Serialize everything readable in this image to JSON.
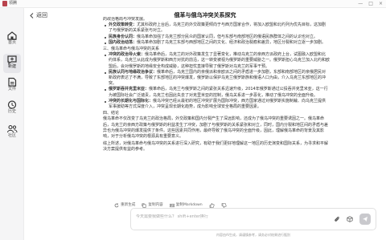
{
  "window": {
    "app_name": "领腾",
    "logo_color": "#b9434d",
    "controls": [
      "—",
      "□",
      "×"
    ]
  },
  "sidebar": {
    "items": [
      {
        "label": "首页",
        "icon": "home-icon"
      },
      {
        "label": "新建",
        "icon": "new-chat-icon",
        "active": true
      },
      {
        "label": "文件",
        "icon": "file-icon"
      },
      {
        "label": "历史",
        "icon": "history-icon"
      },
      {
        "label": "社区",
        "icon": "community-icon"
      }
    ]
  },
  "header": {
    "back_label": "返回",
    "title": "俄革与俄乌冲突关系探究"
  },
  "content": {
    "p0": "的政治格局与冲突发展。",
    "b1": "外交政策转变：",
    "b1t": "尤其科政府上台后，乌克兰的外交政策更倾向于与西方国家合作，将加入欧盟和北约列为优先目标，这加剧了与俄罗斯的关系紧张与对立。",
    "b2": "民族身份认同：",
    "b2t": "俄乌革命加强了乌克兰部分民众的国家认同，但与东部与南部地区的俄语民族群体之间的认识也对立。",
    "b3": "国内政治动荡：",
    "b3t": "俄乌革命加剧了乌克兰东部与西部地区之间的文化、经济和政治裂痕和差异，地区分裂和对立逐一步加剧。",
    "sec3": "三、俄乌革命与俄乌冲突的关系",
    "c1": "冲突的政治导火索：",
    "c1t": "俄乌革命后，乌克兰的对外政策发生了显著变化，推动乌克兰的亲西方派政府上台，试图融入欧盟和北约体系，乌克兰从此成为俄罗斯和西方对抗的前沿，这一转变被视为俄罗斯的重要威胁之一。俄罗斯担心乌克兰加入北约和欧盟后，会对俄罗斯的地缘安全构成威胁，这种担忧直接导致了俄罗斯对乌克兰的军事干预。",
    "c2": "民族认同与地缘政治争议：",
    "c2t": "俄革命后，乌克兰国内的亲俄派和亲欧派之间的矛盾进一步加剧，东部和南部地区的亲俄居民对新政府表达了不满，导致了东部地区的冲突爆发，俄罗斯以保护乌克兰俄罗斯族和俄语人口为由，介入乌克兰东部地区的冲突。",
    "c3": "俄罗斯吞并克里米亚：",
    "c3t": "俄革命后，乌克兰与俄罗斯之间的紧张关系迅速升级，2014年俄罗斯通过公投吞并克里米亚，这一行为被国际社会广泛谴责，乌克兰也因此失去了对克里米亚的控制，俄乌关系进一步恶化，推动了俄乌冲突的全面升级。",
    "c4": "冲突的长期化与国际化：",
    "c4t": "俄乌冲突已经从最初的地区冲突扩展为国际冲突，西方国家通过对俄罗斯实施制裁、向乌克兰提供军事援助等方式深度介入，冲突呈现长期化趋势，成为影响全球安全格局的重要因素。",
    "sec4": "四、结论",
    "concl1": "俄乌革命不仅改变了乌克兰的政治格局，外交政策和国内分裂产生了深远影响，还成为了俄乌冲突的重要诱因之一。俄乌革命后，乌克兰的亲西方政策与俄罗斯的利益发生了冲突，加剧了与俄罗斯的关系紧张和对立，同时，国内分裂和地区间的矛盾与差异也为俄乌冲突的爆发提供了条件。这些因素共同作用，最终导致了俄乌冲突的全面升级，因此，理解俄乌革命的背景及其影响，对于分析俄乌冲突的根源具有重要意义。",
    "concl2": "综上所述，对俄乌革命与俄乌冲突的关系进行深入研究，有助于我们更好地理解这一地区的历史演变和国际关系，为寻求和平解决方案提供有益的参考。"
  },
  "actions": {
    "regenerate": "重新生成",
    "copy_content": "复制内容",
    "copy_markdown": "复制Markdown",
    "like_icon": "thumbs-up-icon",
    "dislike_icon": "thumbs-down-icon"
  },
  "input": {
    "placeholder": "今天需要我做些什么？ shift+enter换行",
    "send_color": "#c9c9cd"
  },
  "footer": {
    "disclaimer": "内容由AI生成，请谨慎参考，请务必对结果进行甄别"
  }
}
